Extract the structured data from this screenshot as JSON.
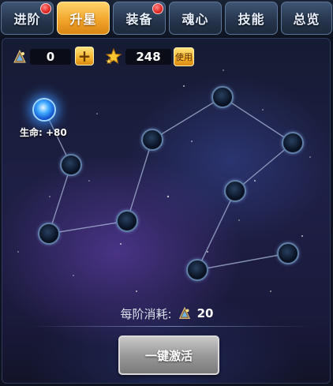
{
  "tabs": [
    {
      "label": "进阶",
      "active": false,
      "badge": true
    },
    {
      "label": "升星",
      "active": true,
      "badge": false
    },
    {
      "label": "装备",
      "active": false,
      "badge": true
    },
    {
      "label": "魂心",
      "active": false,
      "badge": false
    },
    {
      "label": "技能",
      "active": false,
      "badge": false
    },
    {
      "label": "总览",
      "active": false,
      "badge": false
    }
  ],
  "resources": {
    "star_stone": {
      "icon": "star-stone-icon",
      "amount": "0"
    },
    "plus_label": "+",
    "gold_star": {
      "icon": "gold-star-pile-icon",
      "amount": "248"
    },
    "use_label": "使用"
  },
  "constellation": {
    "lit_label": "生命: +80"
  },
  "footer": {
    "cost_label": "每阶消耗:",
    "cost_icon": "star-stone-icon",
    "cost_value": "20",
    "activate_label": "一键激活"
  },
  "colors": {
    "active_tab": "#f2a62c",
    "tab": "#2f4260",
    "lit_star": "#3da8ff",
    "button_disabled": "#9a9a9a"
  }
}
